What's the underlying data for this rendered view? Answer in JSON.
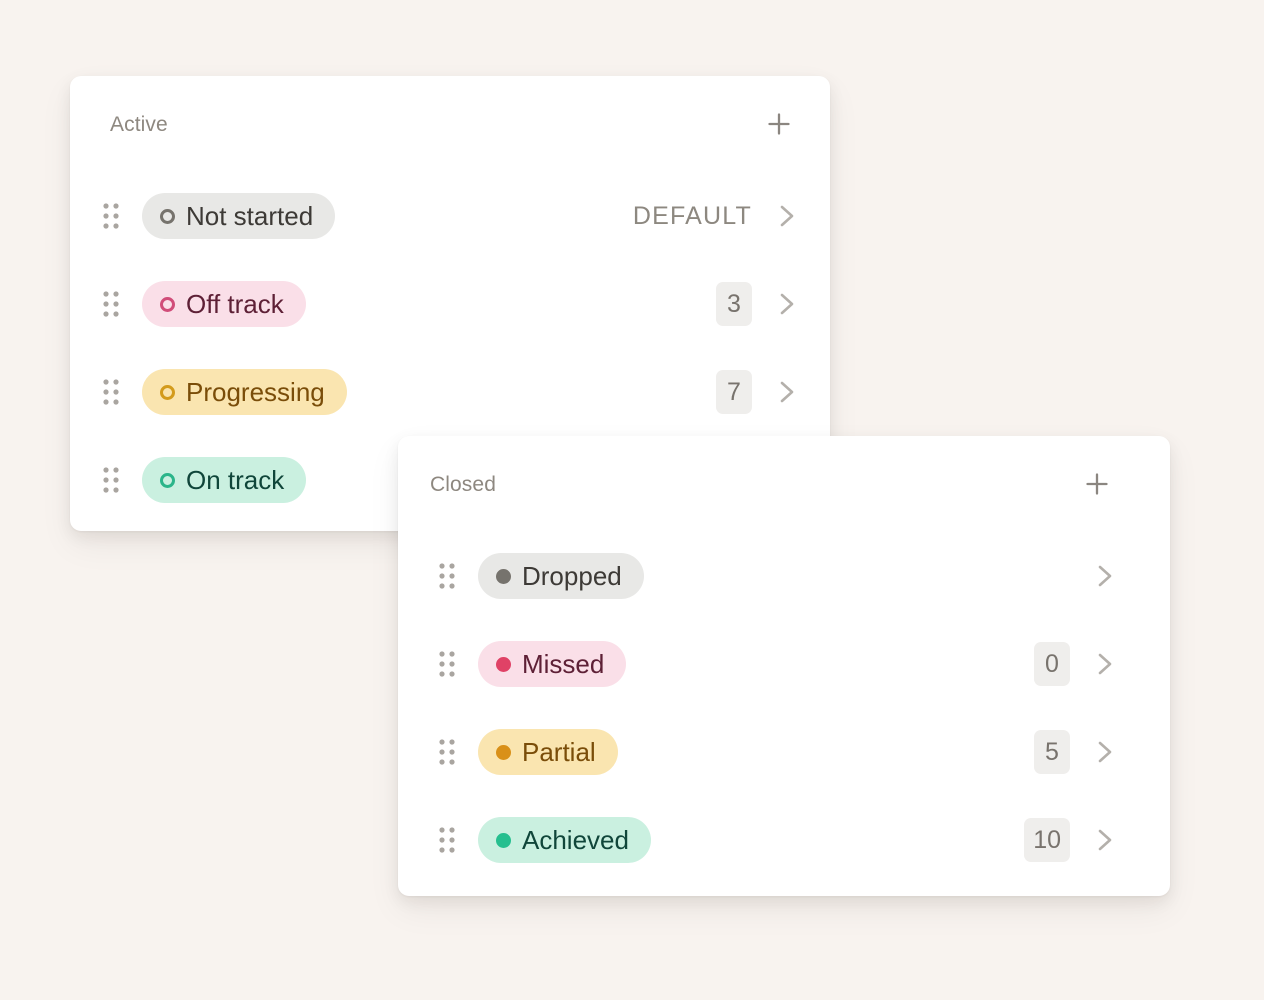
{
  "background_color": "#f8f3ef",
  "cards": [
    {
      "id": "active",
      "title": "Active",
      "add_label": "+",
      "marker_style": "ring",
      "rows": [
        {
          "label": "Not started",
          "pill_bg": "#e8e8e6",
          "pill_text": "#3d3a36",
          "marker_color": "#76736d",
          "badge": "DEFAULT",
          "badge_type": "default-tag"
        },
        {
          "label": "Off track",
          "pill_bg": "#fadfe8",
          "pill_text": "#5e2036",
          "marker_color": "#d14d79",
          "badge": "3",
          "badge_type": "count"
        },
        {
          "label": "Progressing",
          "pill_bg": "#fae5b0",
          "pill_text": "#7a4d09",
          "marker_color": "#d39b1c",
          "badge": "7",
          "badge_type": "count"
        },
        {
          "label": "On track",
          "pill_bg": "#caf0e0",
          "pill_text": "#10463a",
          "marker_color": "#2bb58a",
          "badge": "",
          "badge_type": "none"
        }
      ]
    },
    {
      "id": "closed",
      "title": "Closed",
      "add_label": "+",
      "marker_style": "dot",
      "rows": [
        {
          "label": "Dropped",
          "pill_bg": "#e8e8e6",
          "pill_text": "#3d3a36",
          "marker_color": "#76736d",
          "badge": "",
          "badge_type": "none"
        },
        {
          "label": "Missed",
          "pill_bg": "#fadfe8",
          "pill_text": "#5e2036",
          "marker_color": "#e04266",
          "badge": "0",
          "badge_type": "count"
        },
        {
          "label": "Partial",
          "pill_bg": "#fae5b0",
          "pill_text": "#7a4d09",
          "marker_color": "#d99018",
          "badge": "5",
          "badge_type": "count"
        },
        {
          "label": "Achieved",
          "pill_bg": "#caf0e0",
          "pill_text": "#10463a",
          "marker_color": "#26bf8f",
          "badge": "10",
          "badge_type": "count"
        }
      ]
    }
  ],
  "icons": {
    "add": "plus-icon",
    "drag": "drag-handle-icon",
    "chevron": "chevron-right-icon"
  }
}
